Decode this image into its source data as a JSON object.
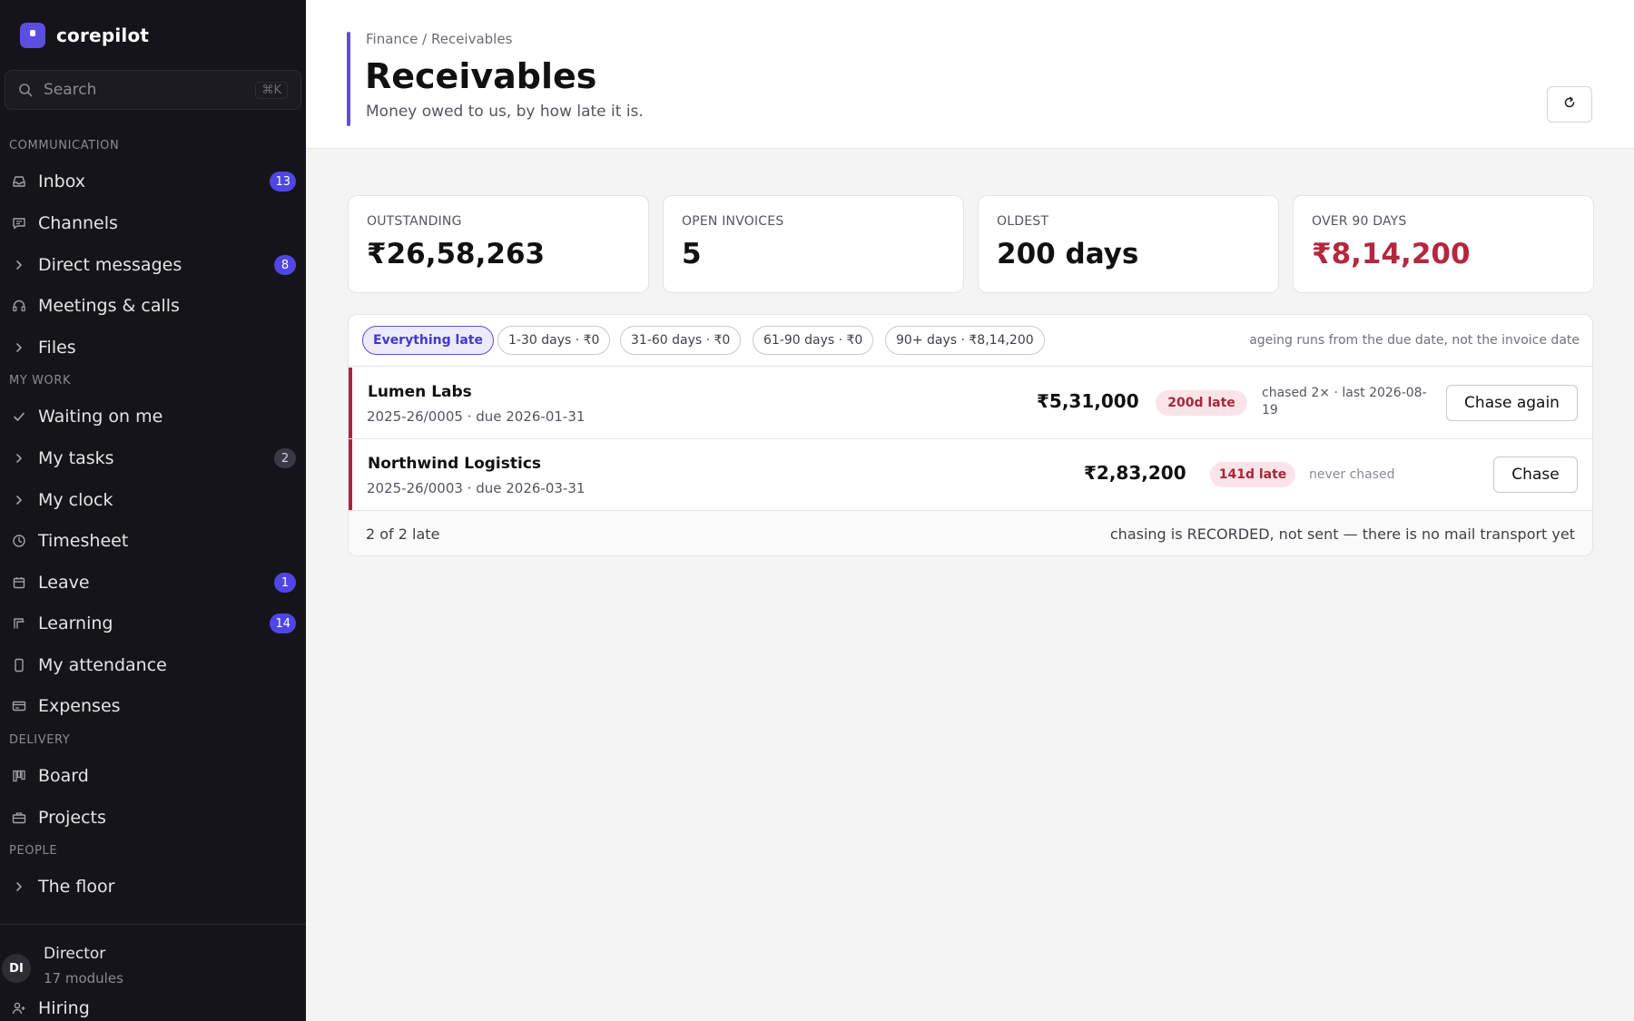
{
  "app": {
    "name": "corepilot",
    "accent": "#5b4fe0"
  },
  "search": {
    "placeholder": "Search",
    "shortcut": "⌘K"
  },
  "sidebar": {
    "sections": [
      {
        "label": "COMMUNICATION"
      },
      {
        "label": "MY WORK"
      },
      {
        "label": "DELIVERY"
      },
      {
        "label": "PEOPLE"
      }
    ],
    "items": [
      {
        "label": "Inbox",
        "icon": "inbox-icon",
        "badge": "13"
      },
      {
        "label": "Channels",
        "icon": "chat-icon"
      },
      {
        "label": "Direct messages",
        "icon": "chevron-right-icon",
        "badge": "8"
      },
      {
        "label": "Meetings & calls",
        "icon": "headset-icon"
      },
      {
        "label": "Files",
        "icon": "chevron-right-icon"
      },
      {
        "label": "Waiting on me",
        "icon": "check-icon"
      },
      {
        "label": "My tasks",
        "icon": "chevron-right-icon",
        "badge": "2"
      },
      {
        "label": "My clock",
        "icon": "chevron-right-icon"
      },
      {
        "label": "Timesheet",
        "icon": "clock-icon"
      },
      {
        "label": "Leave",
        "icon": "calendar-icon",
        "badge": "1"
      },
      {
        "label": "Learning",
        "icon": "book-icon",
        "badge": "14"
      },
      {
        "label": "My attendance",
        "icon": "phone-icon"
      },
      {
        "label": "Expenses",
        "icon": "card-icon"
      },
      {
        "label": "Board",
        "icon": "board-icon"
      },
      {
        "label": "Projects",
        "icon": "briefcase-icon"
      },
      {
        "label": "The floor",
        "icon": "chevron-right-icon"
      }
    ],
    "user": {
      "initials": "DI",
      "name": "Director",
      "sub": "17 modules"
    },
    "hiring": {
      "label": "Hiring",
      "icon": "user-plus-icon"
    }
  },
  "header": {
    "breadcrumb": "Finance / Receivables",
    "title": "Receivables",
    "subtitle": "Money owed to us, by how late it is."
  },
  "stats": [
    {
      "label": "OUTSTANDING",
      "value": "₹26,58,263"
    },
    {
      "label": "OPEN INVOICES",
      "value": "5"
    },
    {
      "label": "OLDEST",
      "value": "200 days"
    },
    {
      "label": "OVER 90 DAYS",
      "value": "₹8,14,200",
      "color": "#b3283f"
    }
  ],
  "filters": {
    "chips": [
      {
        "label": "Everything late",
        "active": true
      },
      {
        "label": "1-30 days · ₹0"
      },
      {
        "label": "31-60 days · ₹0"
      },
      {
        "label": "61-90 days · ₹0"
      },
      {
        "label": "90+ days · ₹8,14,200"
      }
    ],
    "note": "ageing runs from the due date, not the invoice date"
  },
  "rows": [
    {
      "name": "Lumen Labs",
      "meta": "2025-26/0005 · due 2026-01-31",
      "amount": "₹5,31,000",
      "late": "200d late",
      "chase_info": "chased 2× · last 2026-08-19",
      "action": "Chase again"
    },
    {
      "name": "Northwind Logistics",
      "meta": "2025-26/0003 · due 2026-03-31",
      "amount": "₹2,83,200",
      "late": "141d late",
      "chase_info": "never chased",
      "action": "Chase"
    }
  ],
  "footer": {
    "count": "2 of 2 late",
    "note": "chasing is RECORDED, not sent — there is no mail transport yet"
  },
  "colors": {
    "late": "#a3283a",
    "late_bg": "#fbe4e7",
    "sidebar_bg": "#15141a"
  }
}
